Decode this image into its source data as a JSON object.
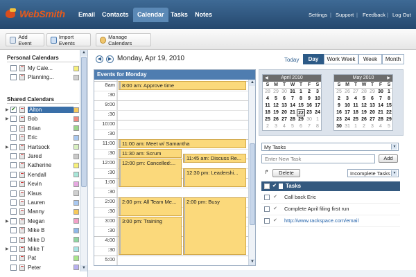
{
  "app": {
    "logo": "WebSmith"
  },
  "nav": {
    "items": [
      "Email",
      "Contacts",
      "Calendar",
      "Tasks",
      "Notes"
    ],
    "active": "Calendar",
    "links": [
      "Settings",
      "Support",
      "Feedback",
      "Log Out"
    ],
    "separator": "|"
  },
  "toolbar": {
    "add_event": "Add Event",
    "import_events": "Import Events",
    "manage_calendars": "Manage Calendars"
  },
  "sidebar": {
    "personal_title": "Personal Calendars",
    "personal": [
      {
        "name": "My Cale...",
        "color": "#f7f07a",
        "checked": false
      },
      {
        "name": "Planning...",
        "color": "#d0d0d0",
        "checked": false
      }
    ],
    "shared_title": "Shared Calendars",
    "shared": [
      {
        "name": "Alton",
        "color": "#f7c95a",
        "checked": true,
        "expand": true,
        "selected": true
      },
      {
        "name": "Bob",
        "color": "#f08a80",
        "checked": false,
        "expand": true
      },
      {
        "name": "Brian",
        "color": "#9bd68a",
        "checked": false
      },
      {
        "name": "Eric",
        "color": "#a9c8f0",
        "checked": false
      },
      {
        "name": "Hartsock",
        "color": "#d8f0c0",
        "checked": false,
        "expand": true
      },
      {
        "name": "Jared",
        "color": "#c9c9c9",
        "checked": false
      },
      {
        "name": "Katherine",
        "color": "#f7f07a",
        "checked": false
      },
      {
        "name": "Kendall",
        "color": "#a8e6d8",
        "checked": false
      },
      {
        "name": "Kevin",
        "color": "#e6a8e0",
        "checked": false
      },
      {
        "name": "Klaus",
        "color": "#cfcfcf",
        "checked": false
      },
      {
        "name": "Lauren",
        "color": "#a9c8f0",
        "checked": false
      },
      {
        "name": "Manny",
        "color": "#f7c95a",
        "checked": false
      },
      {
        "name": "Megan",
        "color": "#f3a0c8",
        "checked": false,
        "expand": true
      },
      {
        "name": "Mike B",
        "color": "#8fb8e8",
        "checked": false
      },
      {
        "name": "Mike D",
        "color": "#8fd6a0",
        "checked": false
      },
      {
        "name": "Mike T",
        "color": "#a8e6e6",
        "checked": false,
        "expand": true
      },
      {
        "name": "Pat",
        "color": "#a9e68a",
        "checked": false
      },
      {
        "name": "Peter",
        "color": "#b8b0f0",
        "checked": false
      }
    ]
  },
  "datebar": {
    "prev": "◀",
    "next": "▶",
    "date": "Monday, Apr 19, 2010",
    "today": "Today",
    "views": [
      "Day",
      "Work Week",
      "Week",
      "Month"
    ],
    "active_view": "Day"
  },
  "day": {
    "header": "Events for Monday",
    "times": [
      "8am",
      ":30",
      "9:00",
      ":30",
      "10:00",
      ":30",
      "11:00",
      ":30",
      "12:00",
      ":30",
      "1:00",
      ":30",
      "2:00",
      ":30",
      "3:00",
      ":30",
      "4:00",
      ":30",
      "5:00"
    ],
    "events": [
      {
        "label": "8:00 am: Approve time",
        "start": 8.0,
        "end": 8.5,
        "col": 0,
        "cols": 1
      },
      {
        "label": "11:00 am: Meet w/ Samantha",
        "start": 11.0,
        "end": 11.5,
        "col": 0,
        "cols": 1
      },
      {
        "label": "11:30 am: Scrum",
        "start": 11.5,
        "end": 12.0,
        "col": 0,
        "cols": 2
      },
      {
        "label": "11:45 am: Discuss Re...",
        "start": 11.75,
        "end": 12.25,
        "col": 1,
        "cols": 2
      },
      {
        "label": "12:00 pm: Cancelled:...",
        "start": 12.0,
        "end": 13.5,
        "col": 0,
        "cols": 2
      },
      {
        "label": "12:30 pm: Leadershi...",
        "start": 12.5,
        "end": 13.5,
        "col": 1,
        "cols": 2
      },
      {
        "label": "2:00 pm: All Team Me...",
        "start": 14.0,
        "end": 15.0,
        "col": 0,
        "cols": 2
      },
      {
        "label": "2:00 pm: Busy",
        "start": 14.0,
        "end": 17.0,
        "col": 1,
        "cols": 2
      },
      {
        "label": "3:00 pm: Training",
        "start": 15.0,
        "end": 17.0,
        "col": 0,
        "cols": 2
      }
    ]
  },
  "mini_calendars": [
    {
      "title": "April 2010",
      "dow": [
        "S",
        "M",
        "T",
        "W",
        "T",
        "F",
        "S"
      ],
      "weeks": [
        [
          "28",
          "29",
          "30",
          "31",
          "1",
          "2",
          "3"
        ],
        [
          "4",
          "5",
          "6",
          "7",
          "8",
          "9",
          "10"
        ],
        [
          "11",
          "12",
          "13",
          "14",
          "15",
          "16",
          "17"
        ],
        [
          "18",
          "19",
          "20",
          "21",
          "22",
          "23",
          "24"
        ],
        [
          "25",
          "26",
          "27",
          "28",
          "29",
          "30",
          "1"
        ],
        [
          "2",
          "3",
          "4",
          "5",
          "6",
          "7",
          "8"
        ]
      ],
      "first_in": 4,
      "last_in": 33,
      "today": 26
    },
    {
      "title": "May 2010",
      "dow": [
        "S",
        "M",
        "T",
        "W",
        "T",
        "F",
        "S"
      ],
      "weeks": [
        [
          "25",
          "26",
          "27",
          "28",
          "29",
          "30",
          "1"
        ],
        [
          "2",
          "3",
          "4",
          "5",
          "6",
          "7",
          "8"
        ],
        [
          "9",
          "10",
          "11",
          "12",
          "13",
          "14",
          "15"
        ],
        [
          "16",
          "17",
          "18",
          "19",
          "20",
          "21",
          "22"
        ],
        [
          "23",
          "24",
          "25",
          "26",
          "27",
          "28",
          "29"
        ],
        [
          "30",
          "31",
          "1",
          "2",
          "3",
          "4",
          "5"
        ]
      ],
      "first_in": 6,
      "last_in": 36,
      "today": -1
    }
  ],
  "tasks": {
    "list_select": "My Tasks",
    "new_placeholder": "Enter New Task",
    "add": "Add",
    "delete": "Delete",
    "filter": "Incomplete Tasks",
    "header": "Tasks",
    "items": [
      {
        "text": "Call back Eric",
        "link": false
      },
      {
        "text": "Complete April filing first run",
        "link": false
      },
      {
        "text": "http://www.rackspace.com/email",
        "link": true
      }
    ]
  },
  "colors": {
    "accent": "#2c5a87",
    "event": "#fbd97b",
    "header": "#4f7db0"
  }
}
